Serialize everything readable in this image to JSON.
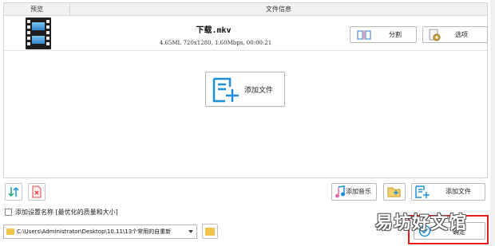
{
  "list_header": {
    "preview": "预览",
    "file_info": "文件信息"
  },
  "file": {
    "name": "下载.mkv",
    "meta": "4.65ML 720x1280, 1.60Mbps, 00:00:21",
    "thumbnail_icon": "film-strip-icon"
  },
  "file_buttons": {
    "split_label": "分割",
    "options_label": "选项"
  },
  "center": {
    "add_file_label": "添加文件"
  },
  "toolbar": {
    "add_music_label": "添加音乐",
    "add_file_label": "添加文件"
  },
  "preset": {
    "checkbox_label": "添加设置名称 [最优化的质量和大小]",
    "checked": false
  },
  "output": {
    "path": "C:\\Users\\Administrator\\Desktop\\10.11\\13个常用的自重新"
  },
  "confirm": {
    "label": "确定"
  },
  "watermark": {
    "text": "易坊好文馆"
  },
  "colors": {
    "accent_blue": "#1c8fd6",
    "highlight_red": "#e51d1d",
    "folder_yellow": "#f2c34a"
  }
}
